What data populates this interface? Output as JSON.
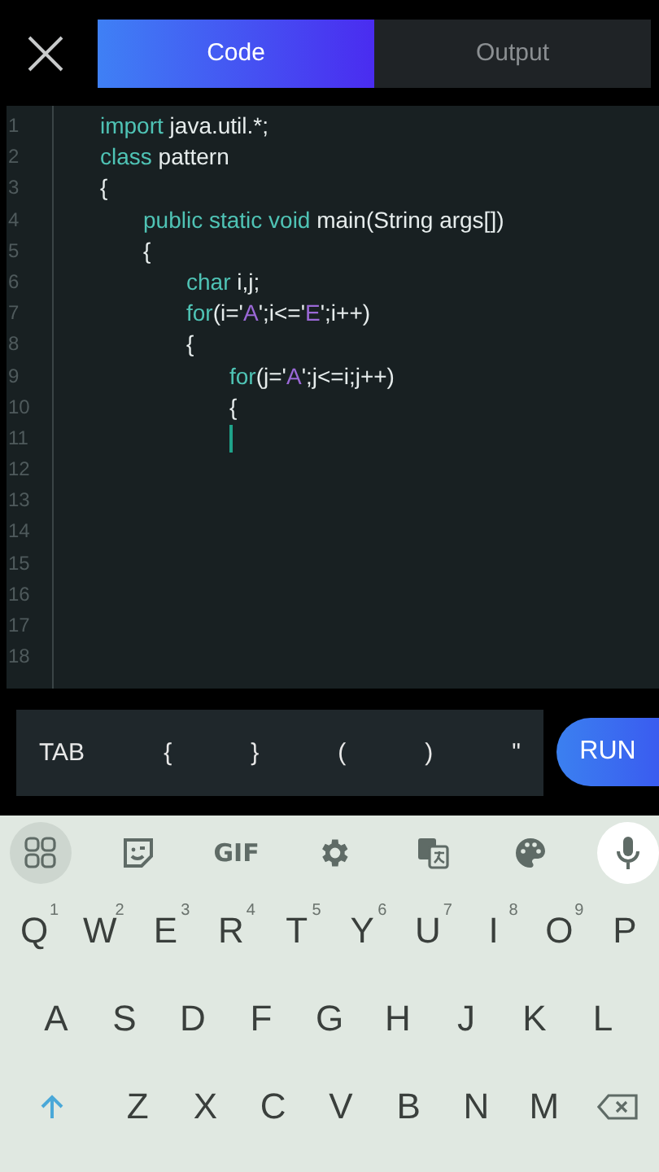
{
  "tabs": [
    {
      "label": "Code",
      "selected": true
    },
    {
      "label": "Output",
      "selected": false
    }
  ],
  "editor": {
    "lines": [
      {
        "number": "1",
        "cursor": false,
        "tokens": [
          {
            "kind": "keyword",
            "text": "\timport"
          },
          {
            "kind": "plain",
            "text": " java.util.*;"
          }
        ]
      },
      {
        "number": "2",
        "cursor": false,
        "tokens": [
          {
            "kind": "keyword",
            "text": "\tclass"
          },
          {
            "kind": "plain",
            "text": " pattern"
          }
        ]
      },
      {
        "number": "3",
        "cursor": false,
        "tokens": [
          {
            "kind": "plain",
            "text": "\t{"
          }
        ]
      },
      {
        "number": "4",
        "cursor": false,
        "tokens": [
          {
            "kind": "keyword",
            "text": "\t\tpublic static void"
          },
          {
            "kind": "plain",
            "text": " main(String args[])"
          }
        ]
      },
      {
        "number": "5",
        "cursor": false,
        "tokens": [
          {
            "kind": "plain",
            "text": "\t\t{"
          }
        ]
      },
      {
        "number": "6",
        "cursor": false,
        "tokens": [
          {
            "kind": "keyword",
            "text": "\t\t\tchar"
          },
          {
            "kind": "plain",
            "text": " i,j;"
          }
        ]
      },
      {
        "number": "7",
        "cursor": false,
        "tokens": [
          {
            "kind": "keyword",
            "text": "\t\t\tfor"
          },
          {
            "kind": "plain",
            "text": "(i='"
          },
          {
            "kind": "string",
            "text": "A"
          },
          {
            "kind": "plain",
            "text": "';i<='"
          },
          {
            "kind": "string",
            "text": "E"
          },
          {
            "kind": "plain",
            "text": "';i++)"
          }
        ]
      },
      {
        "number": "8",
        "cursor": false,
        "tokens": [
          {
            "kind": "plain",
            "text": "\t\t\t{"
          }
        ]
      },
      {
        "number": "9",
        "cursor": false,
        "tokens": [
          {
            "kind": "keyword",
            "text": "\t\t\t\tfor"
          },
          {
            "kind": "plain",
            "text": "(j='"
          },
          {
            "kind": "string",
            "text": "A"
          },
          {
            "kind": "plain",
            "text": "';j<=i;j++)"
          }
        ]
      },
      {
        "number": "10",
        "cursor": false,
        "tokens": [
          {
            "kind": "plain",
            "text": "\t\t\t\t{"
          }
        ]
      },
      {
        "number": "11",
        "cursor": true
      },
      {
        "number": "12",
        "cursor": false
      },
      {
        "number": "13",
        "cursor": false
      },
      {
        "number": "14",
        "cursor": false
      },
      {
        "number": "15",
        "cursor": false
      },
      {
        "number": "16",
        "cursor": false
      },
      {
        "number": "17",
        "cursor": false
      },
      {
        "number": "18",
        "cursor": false
      }
    ]
  },
  "symbol_bar": {
    "keys": [
      "TAB",
      "{",
      "}",
      "(",
      ")",
      "\""
    ],
    "run_button": "RUN"
  },
  "keyboard": {
    "toolbar": [
      {
        "kind": "apps"
      },
      {
        "kind": "sticker"
      },
      {
        "kind": "text",
        "label": "GIF"
      },
      {
        "kind": "settings"
      },
      {
        "kind": "translate"
      },
      {
        "kind": "palette"
      },
      {
        "kind": "mic"
      }
    ],
    "rows": [
      [
        {
          "label": "Q",
          "hint": "1"
        },
        {
          "label": "W",
          "hint": "2"
        },
        {
          "label": "E",
          "hint": "3"
        },
        {
          "label": "R",
          "hint": "4"
        },
        {
          "label": "T",
          "hint": "5"
        },
        {
          "label": "Y",
          "hint": "6"
        },
        {
          "label": "U",
          "hint": "7"
        },
        {
          "label": "I",
          "hint": "8"
        },
        {
          "label": "O",
          "hint": "9"
        },
        {
          "label": "P"
        }
      ],
      [
        {
          "label": "A"
        },
        {
          "label": "S"
        },
        {
          "label": "D"
        },
        {
          "label": "F"
        },
        {
          "label": "G"
        },
        {
          "label": "H"
        },
        {
          "label": "J"
        },
        {
          "label": "K"
        },
        {
          "label": "L"
        }
      ],
      [
        {
          "kind": "shift"
        },
        {
          "label": "Z"
        },
        {
          "label": "X"
        },
        {
          "label": "C"
        },
        {
          "label": "V"
        },
        {
          "label": "B"
        },
        {
          "label": "N"
        },
        {
          "label": "M"
        },
        {
          "kind": "backspace"
        }
      ]
    ]
  }
}
